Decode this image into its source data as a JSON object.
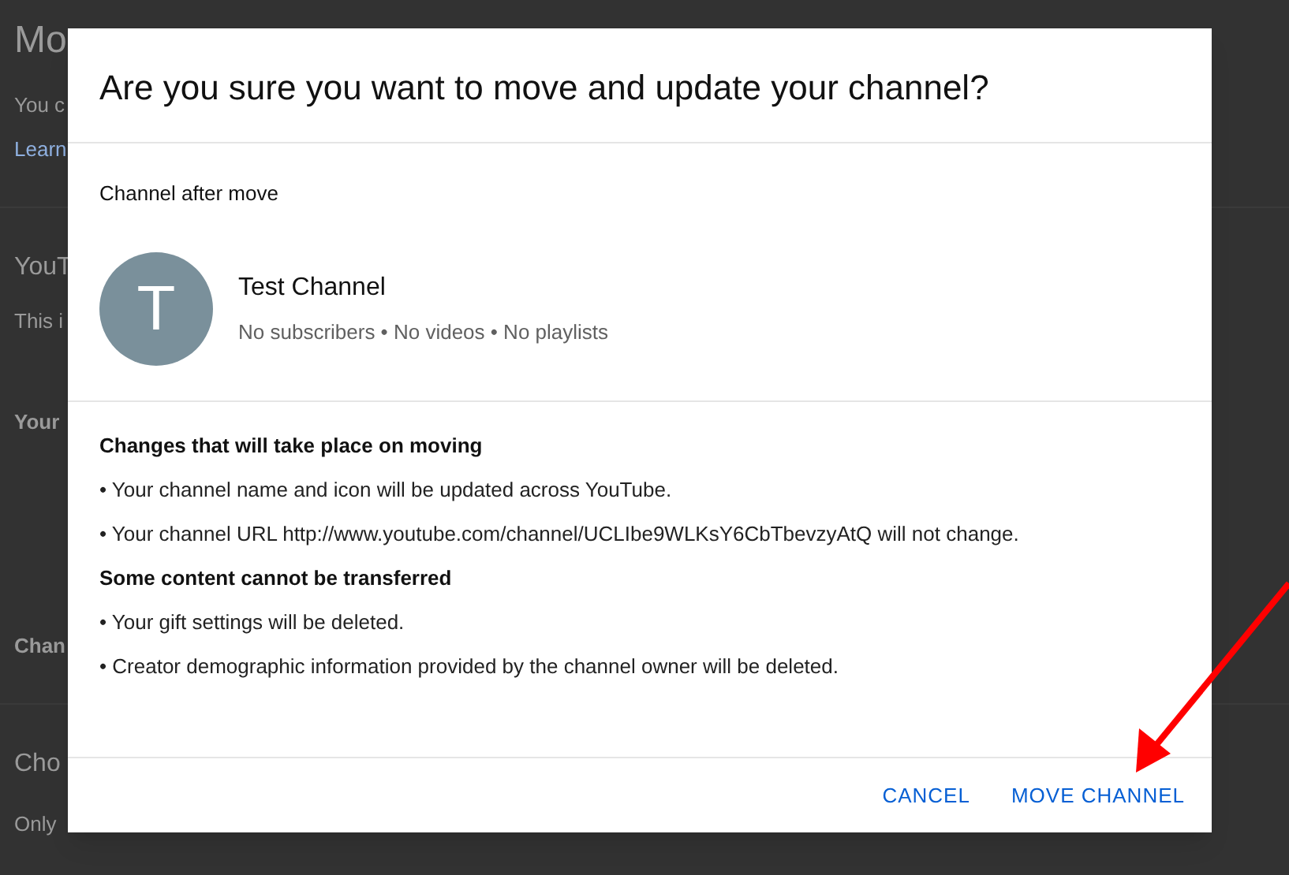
{
  "background": {
    "items": [
      {
        "kind": "title",
        "text": "Mo"
      },
      {
        "kind": "text",
        "text": "You c"
      },
      {
        "kind": "link",
        "text": "Learn"
      },
      {
        "kind": "section",
        "text": "YouT"
      },
      {
        "kind": "text",
        "text": "This i"
      },
      {
        "kind": "subheading",
        "text": "Your"
      },
      {
        "kind": "subheading",
        "text": "Chan"
      },
      {
        "kind": "section",
        "text": "Cho"
      },
      {
        "kind": "text",
        "text": "Only"
      }
    ]
  },
  "dialog": {
    "title": "Are you sure you want to move and update your channel?",
    "channel_label": "Channel after move",
    "channel": {
      "initial": "T",
      "name": "Test Channel",
      "stats": "No subscribers • No videos • No playlists"
    },
    "sections": [
      {
        "heading": "Changes that will take place on moving",
        "items": [
          "• Your channel name and icon will be updated across YouTube.",
          "• Your channel URL http://www.youtube.com/channel/UCLIbe9WLKsY6CbTbevzyAtQ will not change."
        ]
      },
      {
        "heading": "Some content cannot be transferred",
        "items": [
          "• Your gift settings will be deleted.",
          "• Creator demographic information provided by the channel owner will be deleted."
        ]
      }
    ],
    "buttons": [
      "CANCEL",
      "MOVE CHANNEL"
    ]
  }
}
